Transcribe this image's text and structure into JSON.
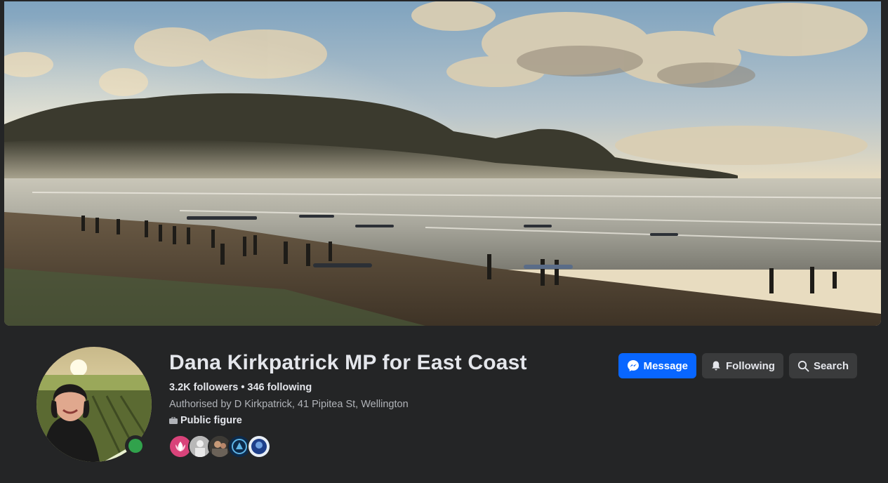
{
  "colors": {
    "background": "#242526",
    "primary_button": "#0866ff",
    "secondary_button": "#3a3b3c",
    "online": "#31a24c"
  },
  "cover": {
    "icon": "cover-photo-beach-landscape"
  },
  "profile": {
    "name": "Dana Kirkpatrick MP for East Coast",
    "followers": "3.2K followers",
    "separator": "•",
    "following": "346 following",
    "authorisation": "Authorised by D Kirkpatrick, 41 Pipitea St, Wellington",
    "category": "Public figure",
    "category_icon": "briefcase-icon"
  },
  "actions": {
    "message": {
      "label": "Message",
      "icon": "messenger-icon"
    },
    "following": {
      "label": "Following",
      "icon": "bell-icon"
    },
    "search": {
      "label": "Search",
      "icon": "search-icon"
    }
  },
  "follower_avatars": [
    "follower-avatar-1",
    "follower-avatar-2",
    "follower-avatar-3",
    "follower-avatar-4",
    "follower-avatar-5"
  ]
}
